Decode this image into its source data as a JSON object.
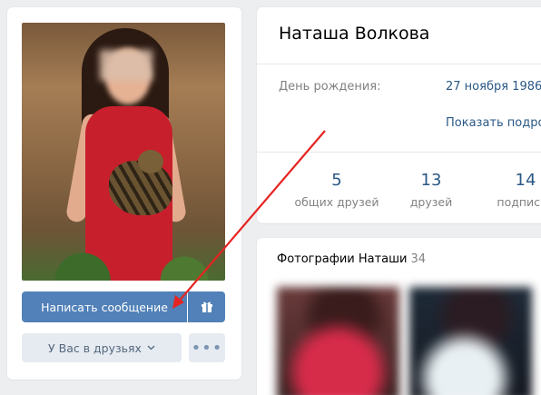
{
  "profile": {
    "name": "Наташа Волкова",
    "birthday_label": "День рождения:",
    "birthday_value": "27 ноября 1986",
    "show_more": "Показать подро"
  },
  "actions": {
    "message_button": "Написать сообщение",
    "friends_button": "У Вас в друзьях",
    "more_button": "•••"
  },
  "stats": [
    {
      "value": "5",
      "label": "общих друзей"
    },
    {
      "value": "13",
      "label": "друзей"
    },
    {
      "value": "14",
      "label": "подписчи"
    }
  ],
  "photos": {
    "title": "Фотографии Наташи",
    "count": "34"
  },
  "colors": {
    "accent": "#5181b8",
    "link": "#2a5885",
    "annotation_arrow": "#e52421"
  },
  "icons": [
    "gift-icon",
    "chevron-down-icon",
    "more-icon"
  ]
}
